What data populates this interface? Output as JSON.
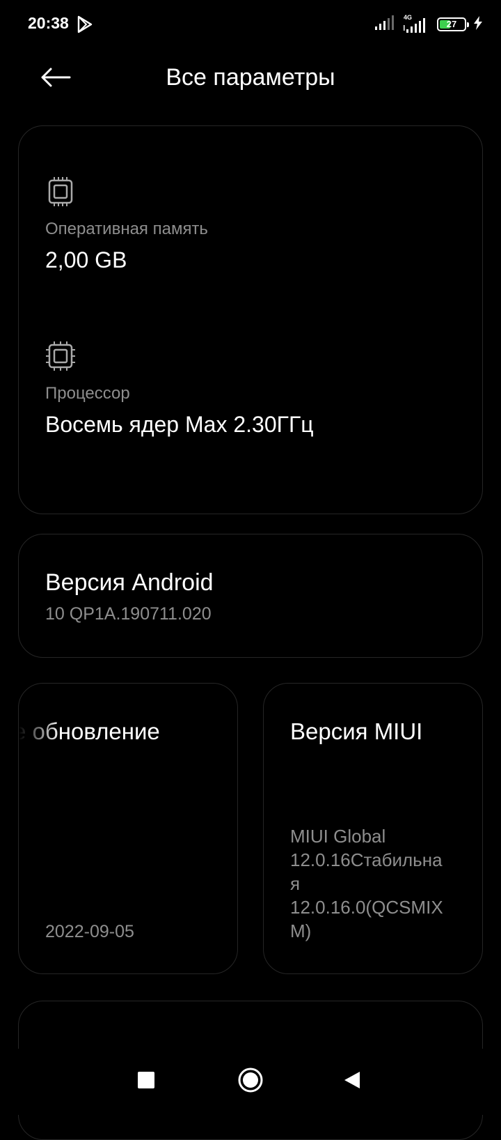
{
  "status_bar": {
    "time": "20:38",
    "network_label": "4G",
    "battery_level": "27",
    "icons": [
      "play-store-icon",
      "signal-icon",
      "signal-4g-icon",
      "battery-icon",
      "charging-bolt-icon"
    ]
  },
  "header": {
    "title": "Все параметры",
    "back_icon": "arrow-left-icon"
  },
  "specs": {
    "ram": {
      "icon": "chip-icon",
      "label": "Оперативная память",
      "value": "2,00 GB"
    },
    "cpu": {
      "icon": "processor-icon",
      "label": "Процессор",
      "value": "Восемь ядер Max 2.30ГГц"
    }
  },
  "android": {
    "title": "Версия Android",
    "value": "10 QP1A.190711.020"
  },
  "update": {
    "title": "е обновление",
    "date": "2022-09-05"
  },
  "miui": {
    "title": "Версия MIUI",
    "value": "MIUI Global\n12.0.16Стабильна\nя\n12.0.16.0(QCSMIX\nM)"
  },
  "nav": {
    "icons": [
      "recents-square-icon",
      "home-circle-icon",
      "back-triangle-icon"
    ]
  },
  "colors": {
    "background": "#000000",
    "text_primary": "#ffffff",
    "text_secondary": "#8e8e8e",
    "card_border": "#262626",
    "battery_fill": "#3ccf4e"
  }
}
